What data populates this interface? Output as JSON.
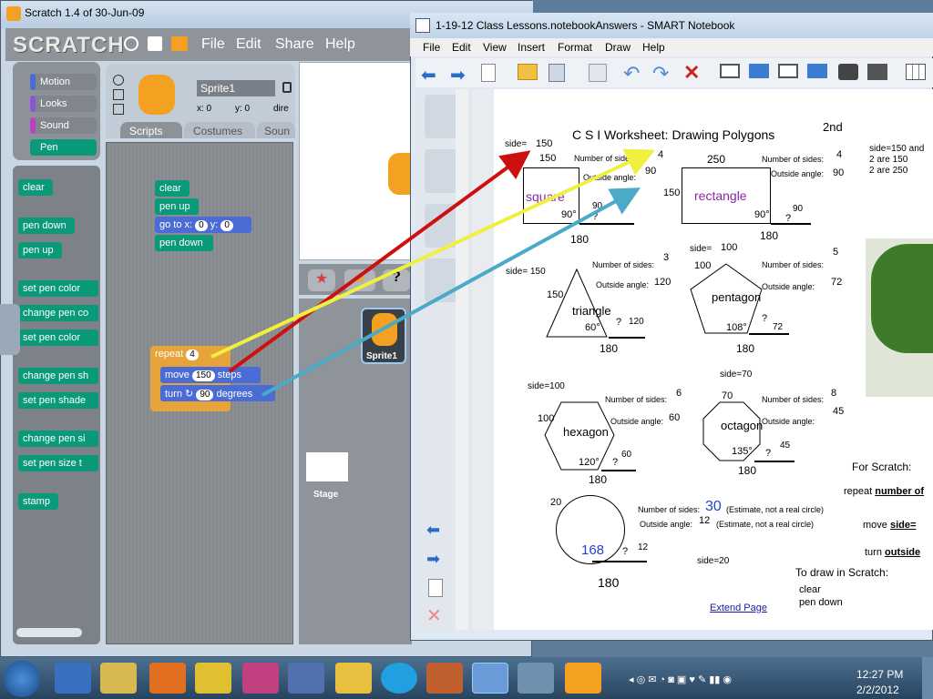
{
  "scratch": {
    "title": "Scratch 1.4 of 30-Jun-09",
    "logo": "SCRATCH",
    "menu": [
      "File",
      "Edit",
      "Share",
      "Help"
    ],
    "categories": [
      "Motion",
      "Looks",
      "Sound",
      "Pen"
    ],
    "category_colors": [
      "#4a6cd4",
      "#8a55d7",
      "#bb42c3",
      "#0a9a7a"
    ],
    "palette_blocks": [
      "clear",
      "pen down",
      "pen up",
      "set pen color",
      "change pen co",
      "set pen color",
      "change pen sh",
      "set pen shade",
      "change pen si",
      "set pen size t",
      "stamp"
    ],
    "sprite_name": "Sprite1",
    "sprite_x_label": "x: 0",
    "sprite_y_label": "y: 0",
    "sprite_dir_label": "dire",
    "tabs": [
      "Scripts",
      "Costumes",
      "Soun"
    ],
    "script1": [
      "clear",
      "pen up",
      "go to x:",
      "pen down"
    ],
    "goto_x": "0",
    "goto_y": "0",
    "goto_y_label": "y:",
    "repeat_label": "repeat",
    "repeat_value": "4",
    "move_label": "move",
    "move_value": "150",
    "move_suffix": "steps",
    "turn_label": "turn",
    "turn_value": "90",
    "turn_suffix": "degrees",
    "sprite_tile_label": "Sprite1",
    "stage_label": "Stage"
  },
  "smart": {
    "title": "1-19-12 Class Lessons.notebookAnswers - SMART Notebook",
    "menu": [
      "File",
      "Edit",
      "View",
      "Insert",
      "Format",
      "Draw",
      "Help"
    ],
    "page_link": "Extend Page"
  },
  "worksheet": {
    "heading": "C S I  Worksheet: Drawing Polygons",
    "corner": "2nd",
    "notes": [
      "side=150 and",
      "2 are 150",
      "2 are 250"
    ],
    "square": {
      "label": "square",
      "side_top": "150",
      "side_left": "side=",
      "side_left_val": "150",
      "angle": "90°",
      "bottom": "180",
      "sides": "4",
      "outside": "90",
      "ext": "90"
    },
    "rectangle": {
      "label": "rectangle",
      "top": "250",
      "left": "150",
      "angle": "90°",
      "bottom": "180",
      "sides": "4",
      "outside": "90",
      "ext": "90"
    },
    "triangle": {
      "label": "triangle",
      "side_label": "side= 150",
      "left": "150",
      "angle": "60°",
      "bottom": "180",
      "sides": "3",
      "outside": "120",
      "ext": "120"
    },
    "pentagon": {
      "label": "pentagon",
      "side_label": "side=",
      "side_val": "100",
      "left": "100",
      "angle": "108°",
      "bottom": "180",
      "sides": "5",
      "outside": "72",
      "ext": "72"
    },
    "hexagon": {
      "label": "hexagon",
      "side_label": "side=100",
      "left": "100",
      "angle": "120°",
      "bottom": "180",
      "sides": "6",
      "outside": "60",
      "ext": "60"
    },
    "octagon": {
      "label": "octagon",
      "side_label": "side=70",
      "left": "70",
      "angle": "135°",
      "bottom": "180",
      "sides": "8",
      "outside": "45",
      "ext": "45"
    },
    "circle": {
      "left": "20",
      "inner": "168",
      "bottom": "180",
      "sides": "30",
      "sides_note": "(Estimate, not a real circle)",
      "outside": "12",
      "outside_note": "(Estimate, not a real circle)",
      "ext": "12",
      "side_label": "side=20"
    },
    "number_of_sides": "Number of sides:",
    "outside_angle": "Outside angle:",
    "question": "?",
    "for_scratch": "For Scratch:",
    "repeat_line": "repeat",
    "repeat_ans": "number of",
    "move_line": "move",
    "move_ans": "side=",
    "turn_line": "turn",
    "turn_ans": "outside",
    "to_draw": "To draw in Scratch:",
    "draw_steps": [
      "clear",
      "pen down"
    ]
  },
  "taskbar": {
    "time": "12:27 PM",
    "date": "2/2/2012"
  },
  "colors": {
    "pen_block": "#0a9a7a",
    "motion_block": "#4a6cd4",
    "control_block": "#e6a33a",
    "arrow_red": "#cc1010",
    "arrow_yellow": "#f0f040",
    "arrow_blue": "#4aaac8",
    "circle_value": "#2244cc"
  }
}
